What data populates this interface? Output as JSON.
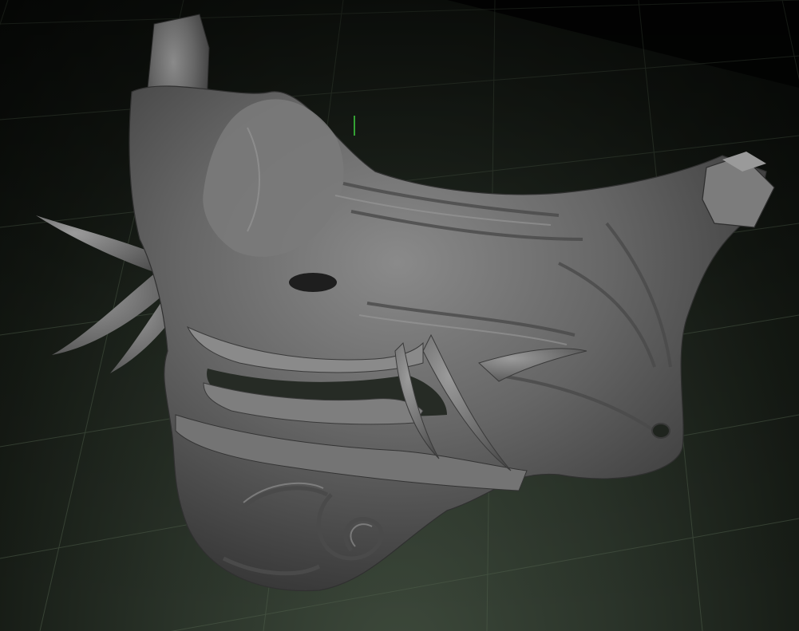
{
  "viewport": {
    "type": "3d-sculpt-viewport",
    "subject": "oni-half-mask",
    "background_color": "#2a3329",
    "floor_grid_color": "#4f5e4b",
    "axis_line_color": "#3fd13f",
    "model_color": "#6a6a6a"
  }
}
